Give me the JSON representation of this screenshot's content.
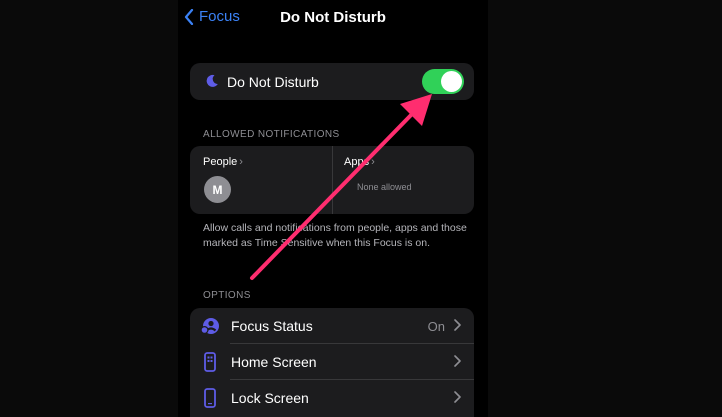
{
  "nav": {
    "back_label": "Focus",
    "title": "Do Not Disturb"
  },
  "dnd_toggle": {
    "label": "Do Not Disturb",
    "state": "on",
    "accent": "#30d158"
  },
  "allowed": {
    "header": "ALLOWED NOTIFICATIONS",
    "people_label": "People",
    "people_avatar_initial": "M",
    "apps_label": "Apps",
    "apps_value": "None allowed"
  },
  "footnote": "Allow calls and notifications from people, apps and those marked as Time Sensitive when this Focus is on.",
  "options": {
    "header": "OPTIONS",
    "rows": [
      {
        "label": "Focus Status",
        "value": "On",
        "icon": "focus-status-icon"
      },
      {
        "label": "Home Screen",
        "value": "",
        "icon": "home-screen-icon"
      },
      {
        "label": "Lock Screen",
        "value": "",
        "icon": "lock-screen-icon"
      }
    ]
  },
  "colors": {
    "accent_blue": "#3b82f6",
    "icon_purple": "#5e5ce6",
    "annotation_arrow": "#ff2d6f"
  }
}
